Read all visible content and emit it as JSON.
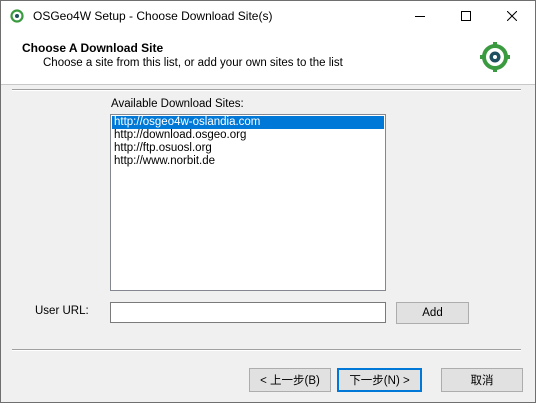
{
  "window": {
    "title": "OSGeo4W Setup - Choose Download Site(s)",
    "controls": {
      "minimize_icon": "minimize-icon",
      "maximize_icon": "maximize-icon",
      "close_icon": "close-icon"
    }
  },
  "header": {
    "title": "Choose A Download Site",
    "subtitle": "Choose a site from this list, or add your own sites to the list"
  },
  "sites": {
    "label": "Available Download Sites:",
    "items": [
      {
        "url": "http://osgeo4w-oslandia.com",
        "selected": true
      },
      {
        "url": "http://download.osgeo.org",
        "selected": false
      },
      {
        "url": "http://ftp.osuosl.org",
        "selected": false
      },
      {
        "url": "http://www.norbit.de",
        "selected": false
      }
    ]
  },
  "user_url": {
    "label": "User URL:",
    "value": "",
    "add_label": "Add"
  },
  "footer": {
    "back_label": "< 上一步(B)",
    "next_label": "下一步(N) >",
    "cancel_label": "取消"
  },
  "colors": {
    "selection": "#0078d7",
    "logo_green": "#3a9a3f",
    "logo_dark": "#1e4f5e"
  }
}
